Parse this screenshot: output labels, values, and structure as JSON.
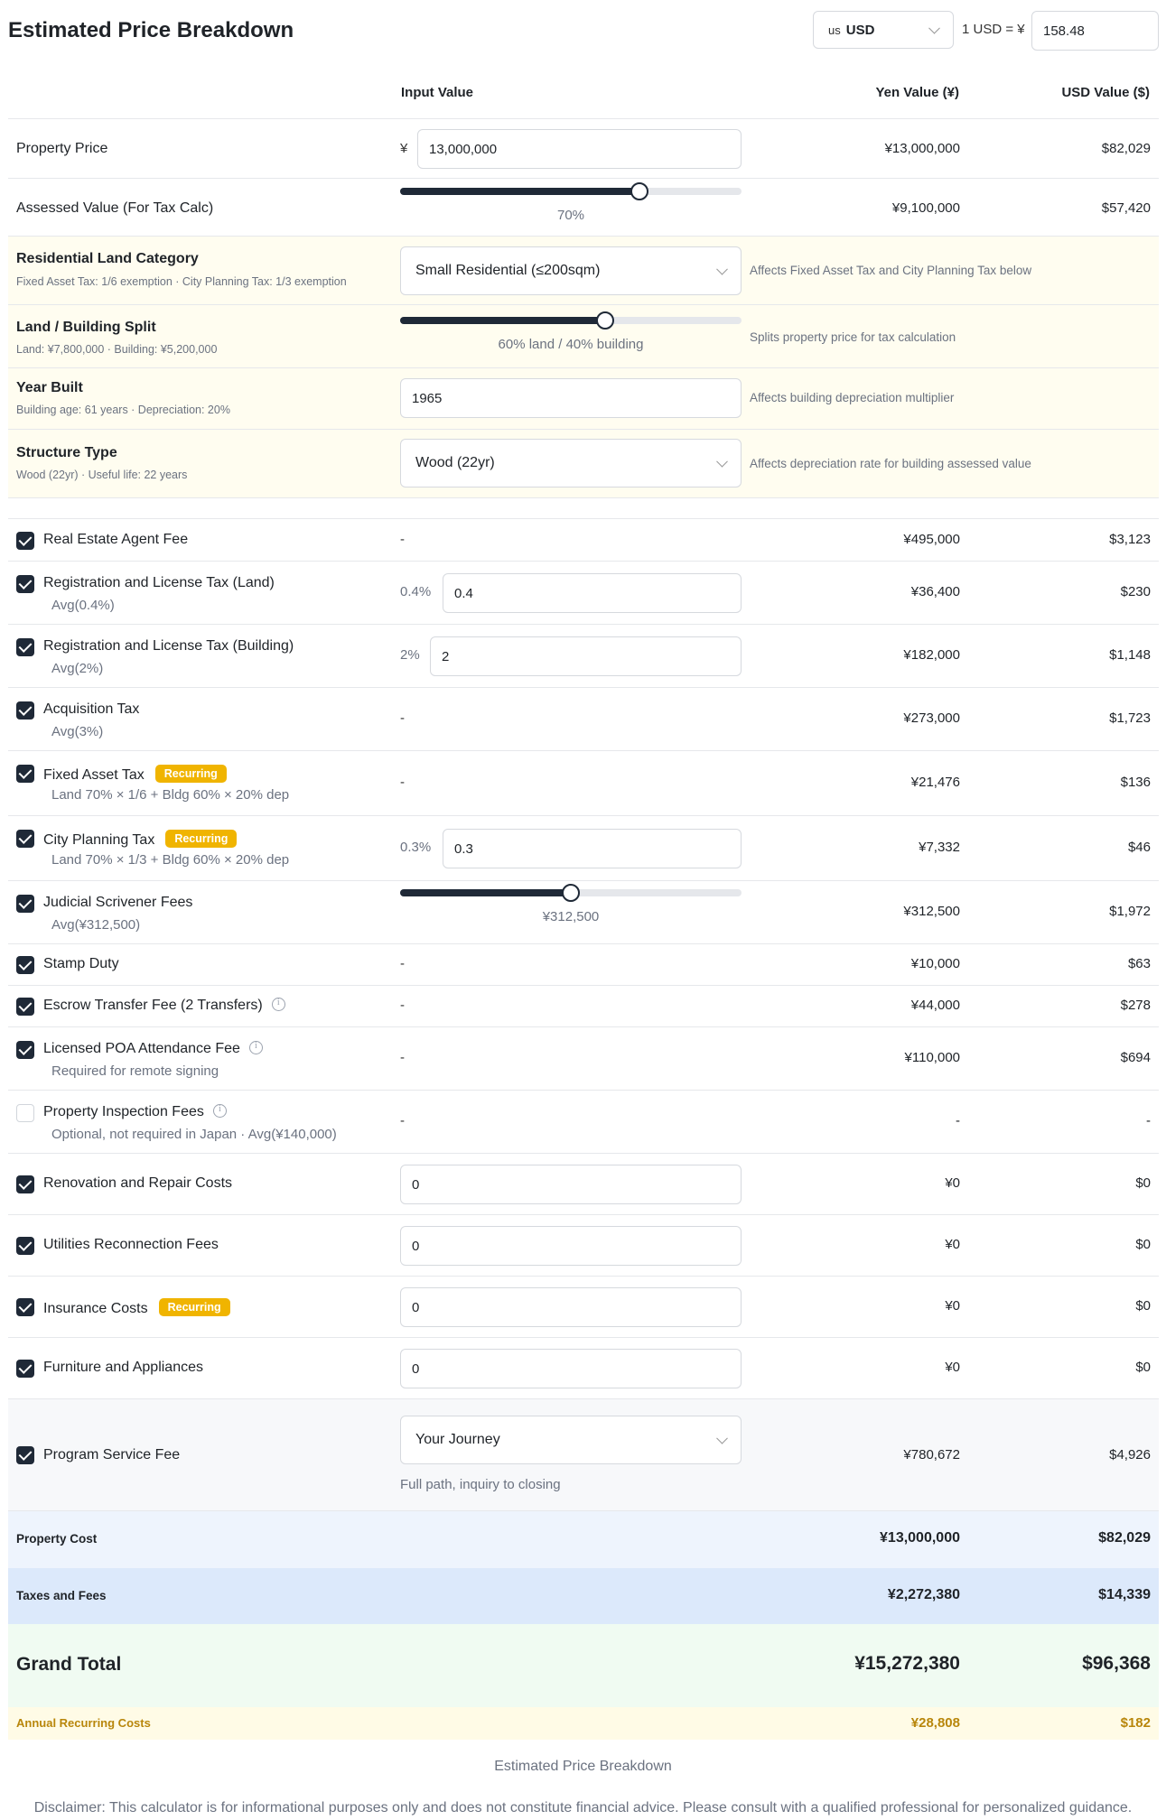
{
  "header": {
    "title": "Estimated Price Breakdown",
    "currency_flag": "us",
    "currency_code": "USD",
    "rate_label": "1 USD = ¥",
    "rate_value": "158.48"
  },
  "columns": {
    "input": "Input Value",
    "yen": "Yen Value (¥)",
    "usd": "USD Value ($)"
  },
  "property_price": {
    "label": "Property Price",
    "prefix": "¥",
    "value": "13,000,000",
    "yen": "¥13,000,000",
    "usd": "$82,029"
  },
  "assessed_value": {
    "label": "Assessed Value (For Tax Calc)",
    "slider_percent": 70,
    "slider_label": "70%",
    "yen": "¥9,100,000",
    "usd": "$57,420"
  },
  "land_category": {
    "label": "Residential Land Category",
    "sub": "Fixed Asset Tax: 1/6 exemption · City Planning Tax: 1/3 exemption",
    "selected": "Small Residential (≤200sqm)",
    "note": "Affects Fixed Asset Tax and City Planning Tax below"
  },
  "land_split": {
    "label": "Land / Building Split",
    "sub": "Land: ¥7,800,000 · Building: ¥5,200,000",
    "slider_percent": 60,
    "slider_label": "60% land / 40% building",
    "note": "Splits property price for tax calculation"
  },
  "year_built": {
    "label": "Year Built",
    "sub": "Building age: 61 years · Depreciation: 20%",
    "value": "1965",
    "note": "Affects building depreciation multiplier"
  },
  "structure_type": {
    "label": "Structure Type",
    "sub": "Wood (22yr) · Useful life: 22 years",
    "selected": "Wood (22yr)",
    "note": "Affects depreciation rate for building assessed value"
  },
  "fees": [
    {
      "label": "Real Estate Agent Fee",
      "sub": "",
      "checked": true,
      "input": "-",
      "yen": "¥495,000",
      "usd": "$3,123"
    },
    {
      "label": "Registration and License Tax (Land)",
      "sub": "Avg(0.4%)",
      "checked": true,
      "prefix": "0.4%",
      "value": "0.4",
      "yen": "¥36,400",
      "usd": "$230"
    },
    {
      "label": "Registration and License Tax (Building)",
      "sub": "Avg(2%)",
      "checked": true,
      "prefix": "2%",
      "value": "2",
      "yen": "¥182,000",
      "usd": "$1,148"
    },
    {
      "label": "Acquisition Tax",
      "sub": "Avg(3%)",
      "checked": true,
      "input": "-",
      "yen": "¥273,000",
      "usd": "$1,723"
    },
    {
      "label": "Fixed Asset Tax",
      "badge": "Recurring",
      "sub": "Land 70% × 1/6 + Bldg 60% × 20% dep",
      "checked": true,
      "input": "-",
      "yen": "¥21,476",
      "usd": "$136"
    },
    {
      "label": "City Planning Tax",
      "badge": "Recurring",
      "sub": "Land 70% × 1/3 + Bldg 60% × 20% dep",
      "checked": true,
      "prefix": "0.3%",
      "value": "0.3",
      "yen": "¥7,332",
      "usd": "$46"
    },
    {
      "label": "Judicial Scrivener Fees",
      "sub": "Avg(¥312,500)",
      "checked": true,
      "slider_percent": 50,
      "slider_label": "¥312,500",
      "yen": "¥312,500",
      "usd": "$1,972"
    },
    {
      "label": "Stamp Duty",
      "sub": "",
      "checked": true,
      "input": "-",
      "yen": "¥10,000",
      "usd": "$63"
    },
    {
      "label": "Escrow Transfer Fee (2 Transfers)",
      "sub": "",
      "checked": true,
      "input": "-",
      "yen": "¥44,000",
      "usd": "$278"
    },
    {
      "label": "Licensed POA Attendance Fee",
      "sub": "Required for remote signing",
      "checked": true,
      "input": "-",
      "yen": "¥110,000",
      "usd": "$694"
    },
    {
      "label": "Property Inspection Fees",
      "sub": "Optional, not required in Japan · Avg(¥140,000)",
      "checked": false,
      "input": "-",
      "yen": "-",
      "usd": "-"
    },
    {
      "label": "Renovation and Repair Costs",
      "checked": true,
      "value": "0",
      "yen": "¥0",
      "usd": "$0"
    },
    {
      "label": "Utilities Reconnection Fees",
      "checked": true,
      "value": "0",
      "yen": "¥0",
      "usd": "$0"
    },
    {
      "label": "Insurance Costs",
      "badge": "Recurring",
      "checked": true,
      "value": "0",
      "yen": "¥0",
      "usd": "$0"
    },
    {
      "label": "Furniture and Appliances",
      "checked": true,
      "value": "0",
      "yen": "¥0",
      "usd": "$0"
    }
  ],
  "program_fee": {
    "label": "Program Service Fee",
    "checked": true,
    "selected": "Your Journey",
    "sub": "Full path, inquiry to closing",
    "yen": "¥780,672",
    "usd": "$4,926"
  },
  "summary": {
    "property_cost": {
      "label": "Property Cost",
      "yen": "¥13,000,000",
      "usd": "$82,029"
    },
    "taxes_fees": {
      "label": "Taxes and Fees",
      "yen": "¥2,272,380",
      "usd": "$14,339"
    },
    "grand_total": {
      "label": "Grand Total",
      "yen": "¥15,272,380",
      "usd": "$96,368"
    },
    "annual_recurring": {
      "label": "Annual Recurring Costs",
      "yen": "¥28,808",
      "usd": "$182"
    }
  },
  "footer": {
    "title": "Estimated Price Breakdown",
    "disclaimer": "Disclaimer: This calculator is for informational purposes only and does not constitute financial advice. Please consult with a qualified professional for personalized guidance."
  },
  "colors": {
    "accent": "#1f2937",
    "badge": "#f0b400",
    "recurring_text": "#b8860b"
  }
}
